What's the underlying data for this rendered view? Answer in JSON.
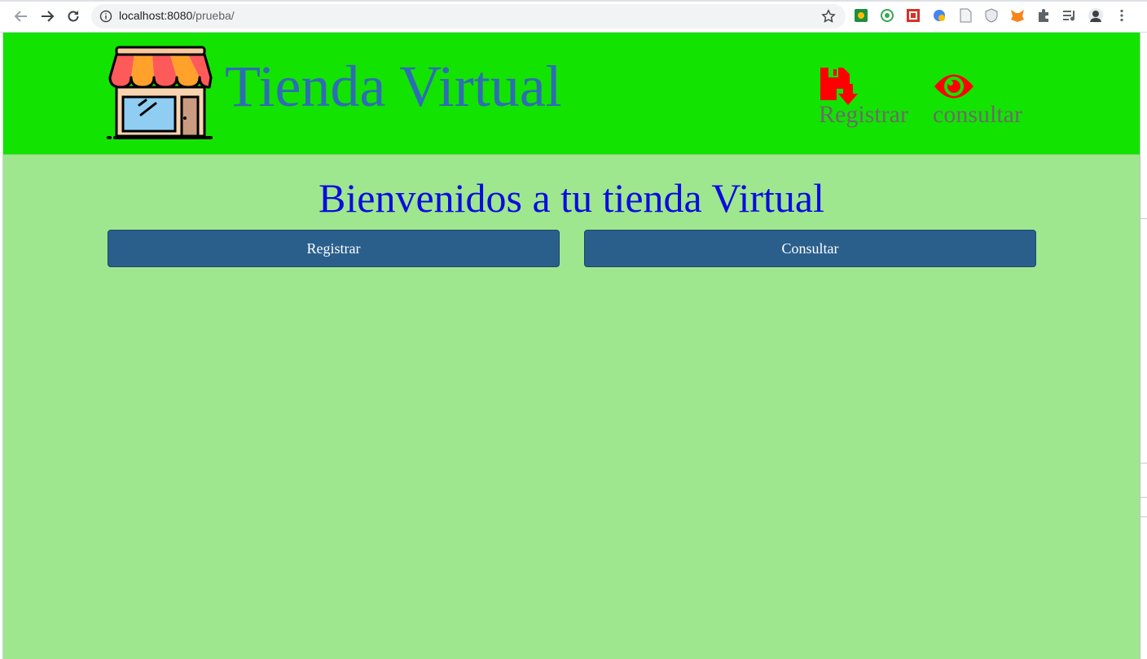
{
  "browser": {
    "url_host": "localhost:8080",
    "url_path": "/prueba/"
  },
  "header": {
    "brand": "Tienda Virtual",
    "nav": [
      {
        "label": "Registrar",
        "icon": "save-icon"
      },
      {
        "label": "consultar",
        "icon": "eye-icon"
      }
    ]
  },
  "main": {
    "welcome": "Bienvenidos a tu tienda Virtual",
    "buttons": [
      {
        "label": "Registrar"
      },
      {
        "label": "Consultar"
      }
    ]
  },
  "colors": {
    "header_bg": "#13e300",
    "page_bg": "#9ee78f",
    "brand_text": "#2e6db5",
    "welcome_text": "#0b0bdf",
    "button_bg": "#2a5f8c",
    "nav_icon": "#ff0000"
  }
}
